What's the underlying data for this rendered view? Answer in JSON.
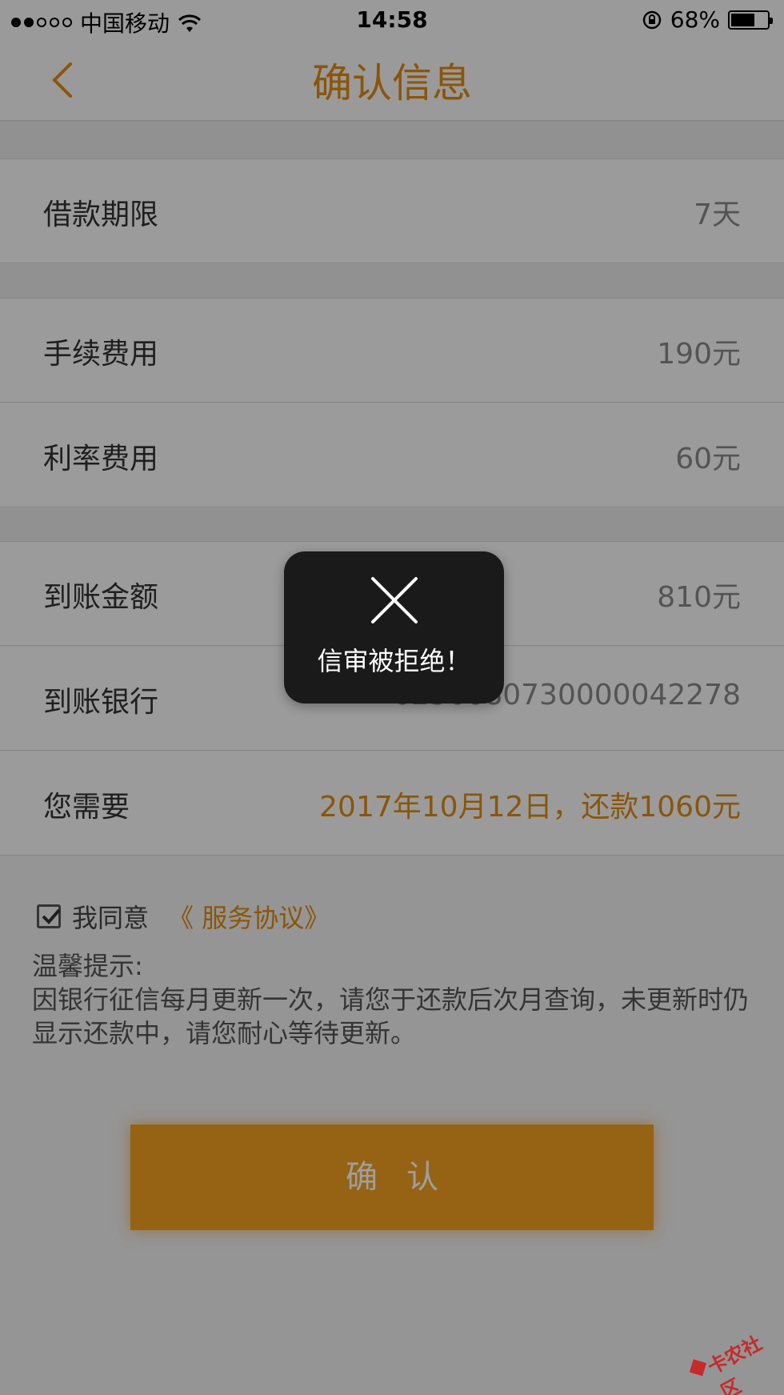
{
  "status_bar": {
    "carrier": "中国移动",
    "time": "14:58",
    "battery": "68%",
    "battery_level": 0.68
  },
  "nav": {
    "title": "确认信息"
  },
  "rows": {
    "term": {
      "label": "借款期限",
      "value": "7天"
    },
    "fee": {
      "label": "手续费用",
      "value": "190元"
    },
    "interest": {
      "label": "利率费用",
      "value": "60元"
    },
    "received": {
      "label": "到账金额",
      "value": "810元"
    },
    "bank": {
      "label": "到账银行",
      "value": "6236680730000042278"
    },
    "repay": {
      "label": "您需要",
      "value": "2017年10月12日，还款1060元"
    }
  },
  "agreement": {
    "checked": true,
    "text": "我同意",
    "link": "《 服务协议》"
  },
  "tip": {
    "title": "温馨提示:",
    "body": "因银行征信每月更新一次，请您于还款后次月查询，未更新时仍显示还款中，请您耐心等待更新。"
  },
  "confirm_button": {
    "label": "确认"
  },
  "toast": {
    "message": "信审被拒绝！"
  },
  "watermark": {
    "text": "卡农社区"
  },
  "colors": {
    "accent": "#e08a10",
    "button": "#f0a020"
  }
}
